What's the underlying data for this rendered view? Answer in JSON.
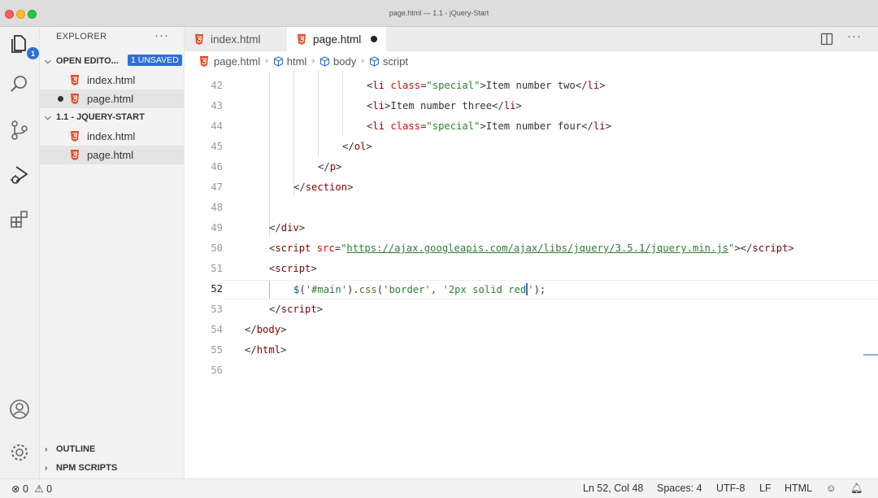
{
  "window": {
    "title": "page.html — 1.1 - jQuery-Start"
  },
  "activity_bar": {
    "explorer_badge": "1"
  },
  "sidebar": {
    "header": "EXPLORER",
    "more": "···",
    "open_editors": {
      "title": "OPEN EDITO...",
      "badge": "1 UNSAVED",
      "files": [
        "index.html",
        "page.html"
      ]
    },
    "project": {
      "title": "1.1 - JQUERY-START",
      "files": [
        "index.html",
        "page.html"
      ]
    },
    "outline": "OUTLINE",
    "npm_scripts": "NPM SCRIPTS"
  },
  "tabs": [
    {
      "label": "index.html"
    },
    {
      "label": "page.html"
    }
  ],
  "breadcrumb": [
    "page.html",
    "html",
    "body",
    "script"
  ],
  "editor": {
    "line_numbers": [
      "42",
      "43",
      "44",
      "45",
      "46",
      "47",
      "48",
      "49",
      "50",
      "51",
      "52",
      "53",
      "54",
      "55",
      "56"
    ],
    "lines": {
      "l42": {
        "text": "Item number two"
      },
      "l43": {
        "text": "Item number three"
      },
      "l44": {
        "text": "Item number four"
      },
      "class_attr": "class",
      "class_value": "\"special\"",
      "script_src": "https://ajax.googleapis.com/ajax/libs/jquery/3.5.1/jquery.min.js",
      "jq_selector": "'#main'",
      "jq_method": "css",
      "jq_arg1": "'border'",
      "jq_arg2_a": "'2px solid red",
      "jq_arg2_b": "'"
    }
  },
  "status": {
    "errors": "0",
    "warnings": "0",
    "position": "Ln 52, Col 48",
    "spaces": "Spaces: 4",
    "encoding": "UTF-8",
    "eol": "LF",
    "language": "HTML"
  },
  "colors": {
    "accent": "#2d6fd6",
    "html_icon": "#e44d26",
    "tag": "#800000",
    "attr": "#e50000",
    "string": "#2e7d32"
  }
}
